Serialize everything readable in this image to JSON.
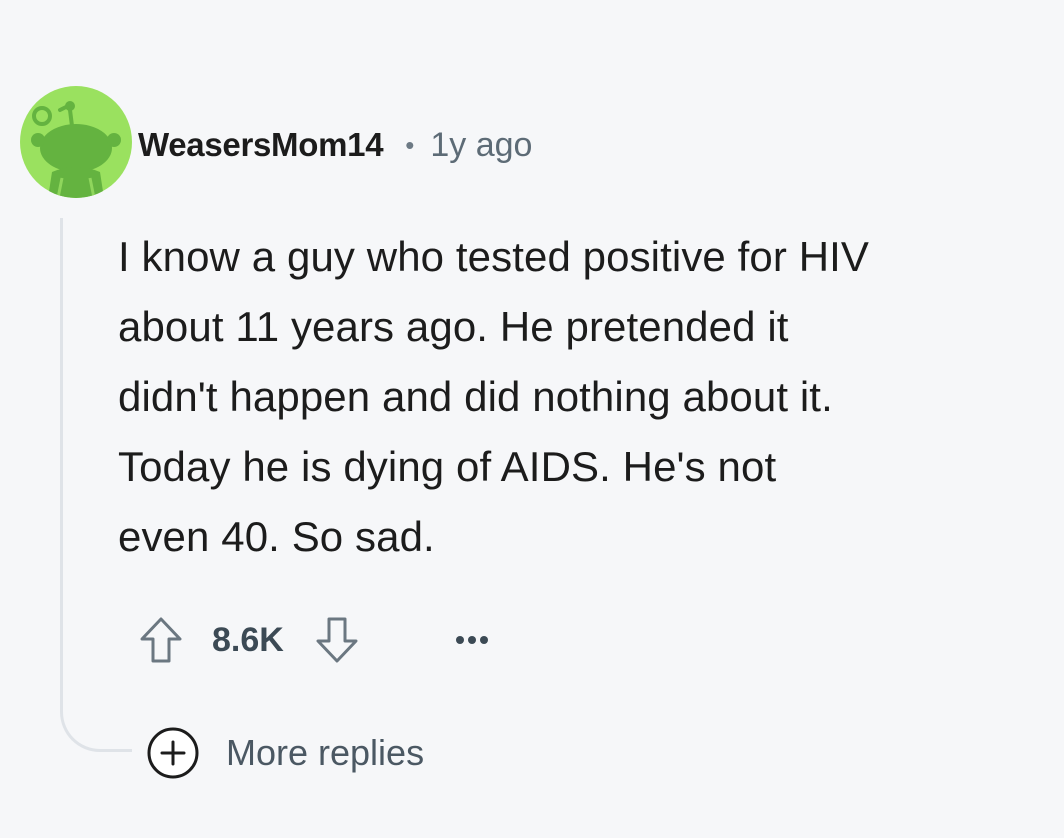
{
  "comment": {
    "username": "WeasersMom14",
    "separator": "•",
    "time": "1y ago",
    "body_lines": [
      "I know a guy who tested positive for HIV",
      "about 11 years ago. He pretended it",
      "didn't happen and did nothing about it.",
      "Today he is dying of AIDS. He's not",
      "even 40. So sad."
    ],
    "score": "8.6K",
    "more_replies_label": "More replies"
  },
  "icons": {
    "avatar": "reddit-snoo-avatar",
    "upvote": "arrow-up-outline-icon",
    "downvote": "arrow-down-outline-icon",
    "more": "ellipsis-icon",
    "expand": "plus-circle-icon"
  },
  "colors": {
    "background": "#f6f7f9",
    "avatar_bg": "#9ae15f",
    "avatar_snoo": "#64b340",
    "text_primary": "#1c1c1c",
    "text_secondary": "#5d6b76",
    "thread_line": "#dfe3e8"
  }
}
